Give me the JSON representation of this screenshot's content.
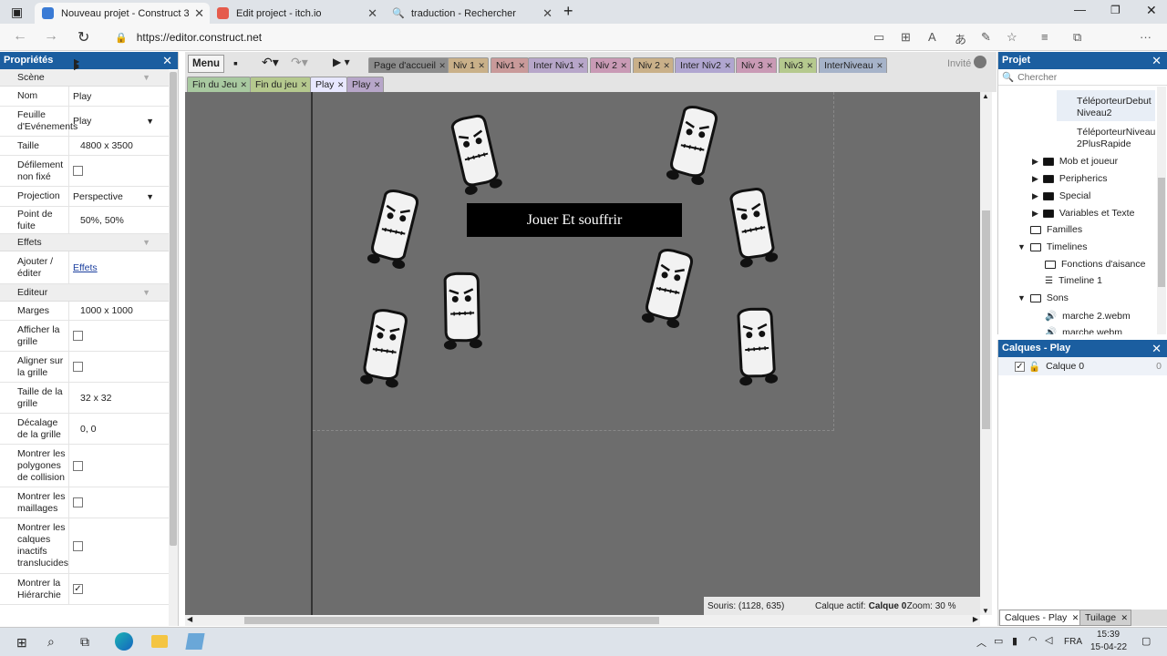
{
  "browser": {
    "tabs": [
      {
        "title": "Nouveau projet - Construct 3",
        "active": true,
        "icon_color": "#3a7bd5"
      },
      {
        "title": "Edit project - itch.io",
        "active": false,
        "icon_color": "#e55b4c"
      },
      {
        "title": "traduction - Rechercher",
        "active": false,
        "icon_color": "#3a7bd5"
      }
    ],
    "url": "https://editor.construct.net"
  },
  "properties": {
    "title": "Propriétés",
    "sections": {
      "scene": "Scène",
      "effets": "Effets",
      "editeur": "Editeur"
    },
    "rows": {
      "nom": {
        "label": "Nom",
        "value": "Play"
      },
      "feuille": {
        "label": "Feuille d'Evénements",
        "value": "Play"
      },
      "taille": {
        "label": "Taille",
        "value": "4800 x 3500"
      },
      "defilement": {
        "label": "Défilement non fixé"
      },
      "projection": {
        "label": "Projection",
        "value": "Perspective"
      },
      "fuite": {
        "label": "Point de fuite",
        "value": "50%, 50%"
      },
      "ajouter": {
        "label": "Ajouter / éditer",
        "value": "Effets"
      },
      "marges": {
        "label": "Marges",
        "value": "1000 x 1000"
      },
      "afficher_grille": {
        "label": "Afficher la grille"
      },
      "aligner_grille": {
        "label": "Aligner sur la grille"
      },
      "taille_grille": {
        "label": "Taille de la grille",
        "value": "32 x 32"
      },
      "decalage": {
        "label": "Décalage de la grille",
        "value": "0, 0"
      },
      "polygones": {
        "label": "Montrer les polygones de collision"
      },
      "maillages": {
        "label": "Montrer les maillages"
      },
      "calques_inactifs": {
        "label": "Montrer les calques inactifs translucides"
      },
      "hierarchie": {
        "label": "Montrer la Hiérarchie",
        "checked": true
      }
    }
  },
  "editor": {
    "menu_label": "Menu",
    "invite_label": "Invité",
    "layout_tabs": [
      {
        "label": "Page d'accueil",
        "color": "#8c8c8c"
      },
      {
        "label": "Niv 1",
        "color": "#c9b089"
      },
      {
        "label": "Niv1",
        "color": "#c99a9a"
      },
      {
        "label": "Inter Niv1",
        "color": "#b7a6c9"
      },
      {
        "label": "Niv 2",
        "color": "#c99ab5"
      },
      {
        "label": "Niv 2",
        "color": "#c9b089"
      },
      {
        "label": "Inter Niv2",
        "color": "#b0a6d0"
      },
      {
        "label": "Niv 3",
        "color": "#c99ab5"
      },
      {
        "label": "Niv3",
        "color": "#b5c98e"
      },
      {
        "label": "InterNiveau",
        "color": "#a6b3c9"
      }
    ],
    "layout_tabs2": [
      {
        "label": "Fin du Jeu",
        "color": "#a8c9a0"
      },
      {
        "label": "Fin du jeu",
        "color": "#b5c98e"
      },
      {
        "label": "Play",
        "color": "#e8e8ff",
        "active": true
      },
      {
        "label": "Play",
        "color": "#b7a6c9"
      }
    ],
    "canvas_button": "Jouer Et souffrir",
    "status": {
      "souris": "Souris: (1128, 635)",
      "calque_prefix": "Calque actif:",
      "calque_name": "Calque 0",
      "zoom": "Zoom: 30 %"
    }
  },
  "project": {
    "title": "Projet",
    "search_placeholder": "Chercher",
    "items": {
      "tp1": "TéléporteurDebut Niveau2",
      "tp2": "TéléporteurNiveau2PlusRapide",
      "mob": "Mob et joueur",
      "peri": "Peripherics",
      "special": "Special",
      "vars": "Variables et Texte",
      "familles": "Familles",
      "timelines": "Timelines",
      "fonctions": "Fonctions d'aisance",
      "timeline1": "Timeline 1",
      "sons": "Sons",
      "marche2": "marche 2.webm",
      "marche": "marche.webm"
    }
  },
  "layers": {
    "title": "Calques - Play",
    "layer_name": "Calque 0",
    "layer_index": "0",
    "tabs": [
      "Calques - Play",
      "Tuilage"
    ]
  },
  "taskbar": {
    "lang": "FRA",
    "time": "15:39",
    "date": "15-04-22"
  }
}
